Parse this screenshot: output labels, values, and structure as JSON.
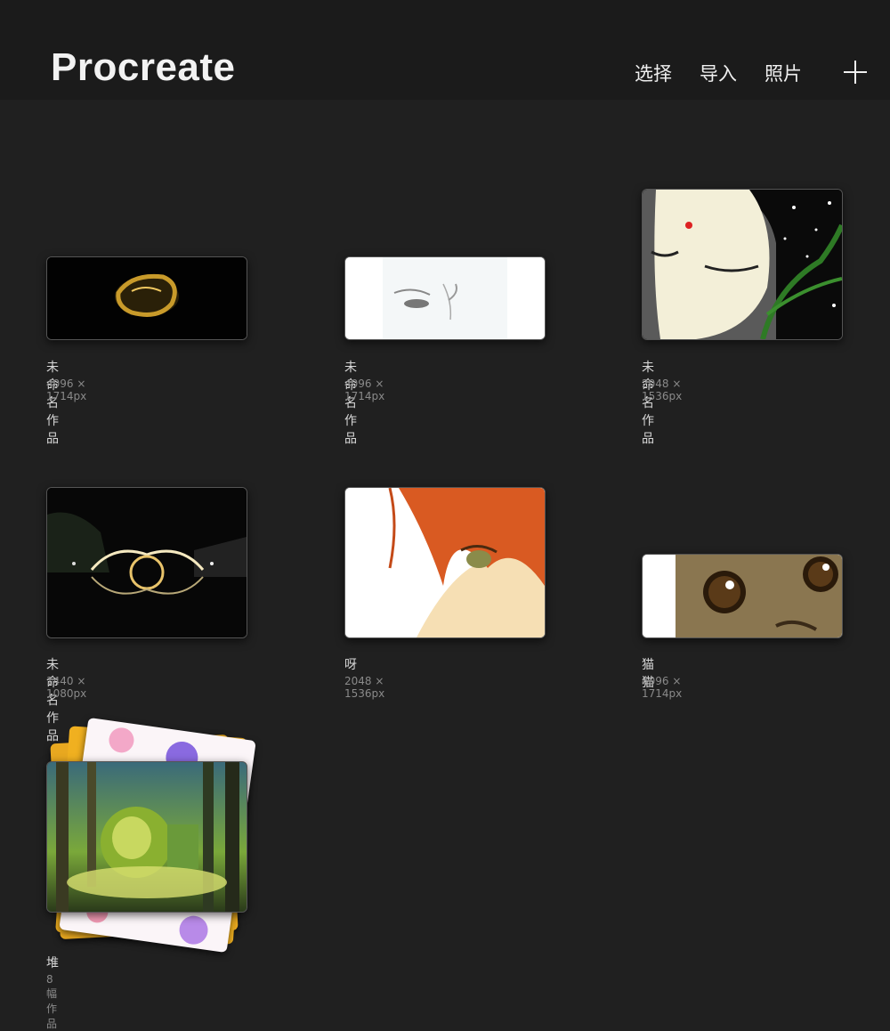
{
  "header": {
    "app_title": "Procreate",
    "select_label": "选择",
    "import_label": "导入",
    "photos_label": "照片"
  },
  "gallery": [
    {
      "title": "未命名作品",
      "size": "4096 × 1714px",
      "icon": "gold-ring-artwork"
    },
    {
      "title": "未命名作品",
      "size": "4096 × 1714px",
      "icon": "face-sketch-artwork"
    },
    {
      "title": "未命名作品",
      "size": "2048 × 1536px",
      "icon": "long-hair-woman-artwork"
    },
    {
      "title": "未命名作品",
      "size": "1440 × 1080px",
      "icon": "night-bridge-artwork"
    },
    {
      "title": "呀",
      "size": "2048 × 1536px",
      "icon": "red-hair-character-artwork"
    },
    {
      "title": "猫猫",
      "size": "4096 × 1714px",
      "icon": "cat-eyes-artwork"
    },
    {
      "title": "堆",
      "size": "8 幅作品",
      "icon": "forest-stack-artwork"
    }
  ],
  "colors": {
    "background": "#202020",
    "topbar": "#1b1b1b",
    "accent": "#f0f0f0"
  }
}
